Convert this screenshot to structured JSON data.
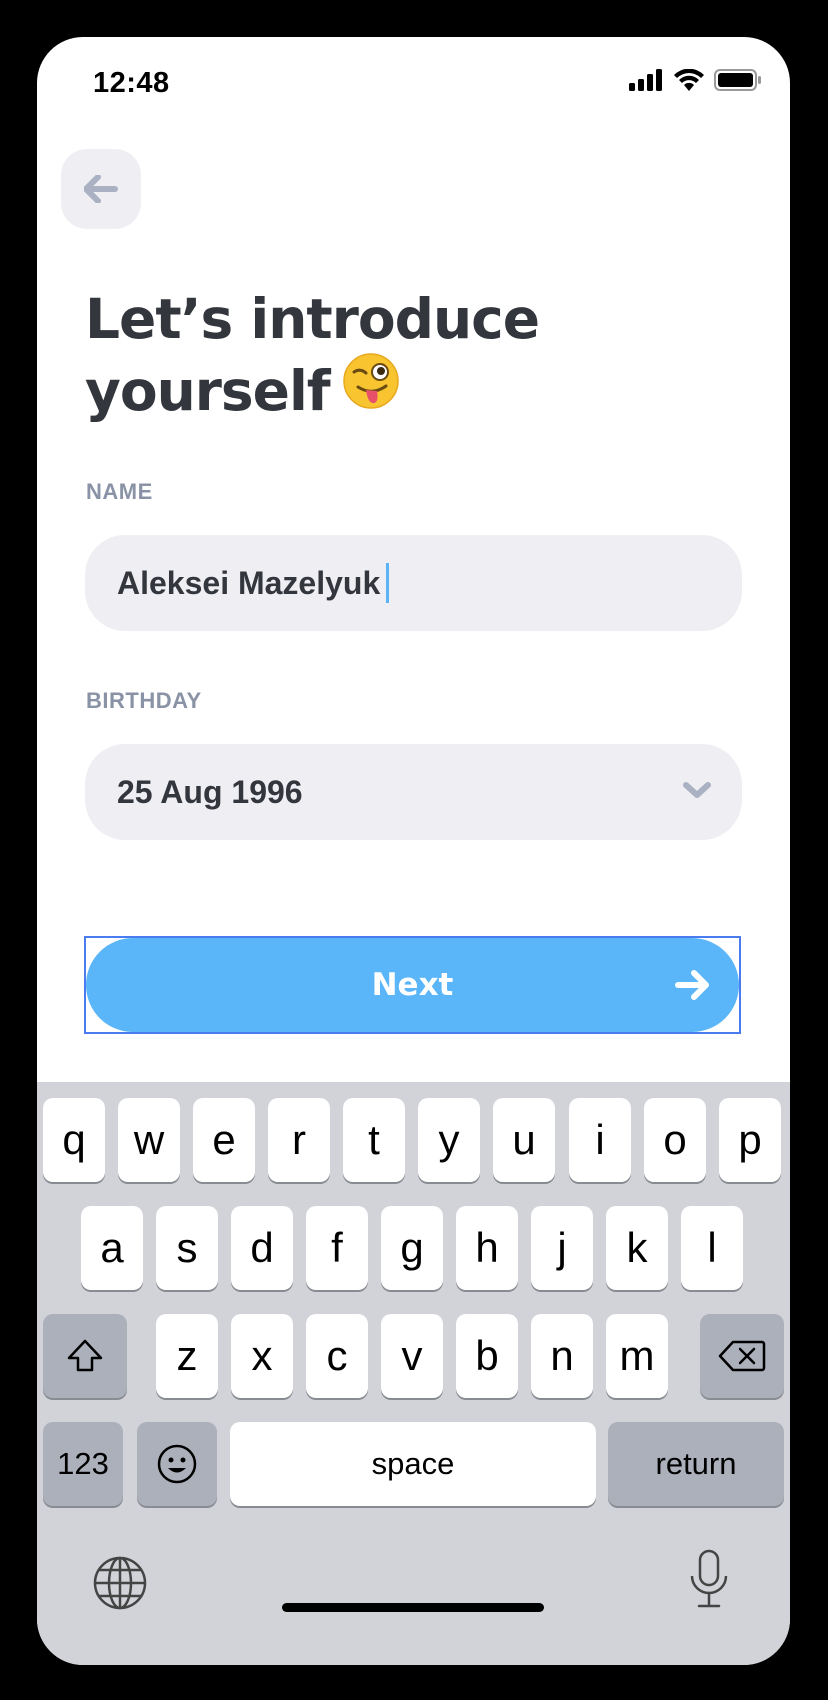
{
  "status_bar": {
    "time": "12:48"
  },
  "header": {
    "title_line1": "Let’s introduce",
    "title_line2": "yourself"
  },
  "form": {
    "name_label": "NAME",
    "name_value": "Aleksei Mazelyuk",
    "birthday_label": "BIRTHDAY",
    "birthday_value": "25 Aug 1996"
  },
  "next_button": {
    "label": "Next"
  },
  "keyboard": {
    "row1": [
      "q",
      "w",
      "e",
      "r",
      "t",
      "y",
      "u",
      "i",
      "o",
      "p"
    ],
    "row2": [
      "a",
      "s",
      "d",
      "f",
      "g",
      "h",
      "j",
      "k",
      "l"
    ],
    "row3": [
      "z",
      "x",
      "c",
      "v",
      "b",
      "n",
      "m"
    ],
    "numbers_key": "123",
    "space_key": "space",
    "return_key": "return"
  },
  "colors": {
    "accent": "#5ab6f8",
    "field_bg": "#efeff3",
    "label": "#8a93a6",
    "text": "#33363d"
  },
  "icons": [
    "back-arrow-icon",
    "wink-emoji-icon",
    "chevron-down-icon",
    "arrow-right-icon",
    "shift-icon",
    "delete-icon",
    "emoji-icon",
    "globe-icon",
    "microphone-icon"
  ]
}
